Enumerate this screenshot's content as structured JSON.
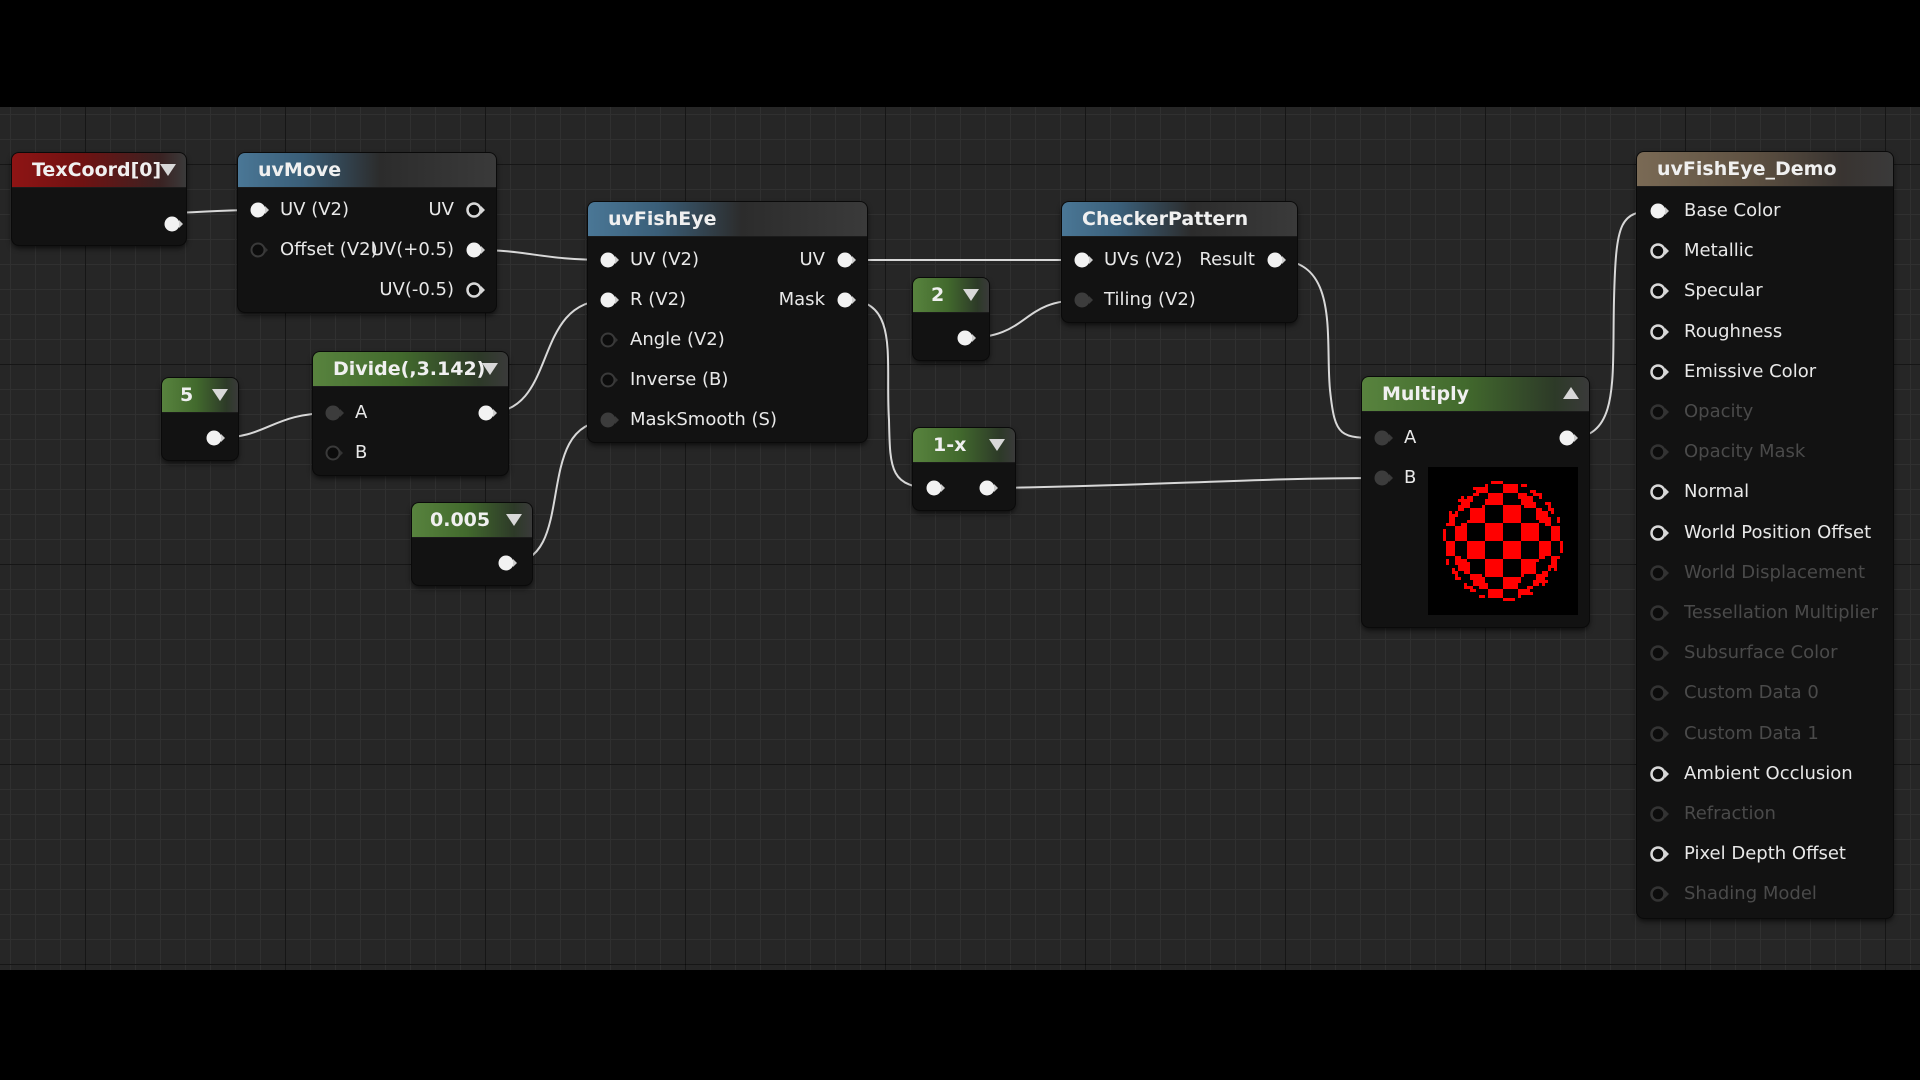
{
  "editor": {
    "type": "material-graph",
    "colors": {
      "background": "#262626",
      "wire": "#d8d8d8",
      "preview_red": "#ff0000",
      "preview_black": "#000000",
      "header_function": "#4a7796",
      "header_texcoord": "#8e1414",
      "header_constant": "#58833e",
      "header_result": "#7a6a55"
    }
  },
  "nodes": {
    "texcoord": {
      "title": "TexCoord[0]"
    },
    "uvmove": {
      "title": "uvMove",
      "inputs": [
        "UV (V2)",
        "Offset (V2)"
      ],
      "outputs": [
        "UV",
        "UV(+0.5)",
        "UV(-0.5)"
      ]
    },
    "const5": {
      "title": "5"
    },
    "divide": {
      "title": "Divide(,3.142)",
      "inputs": [
        "A",
        "B"
      ]
    },
    "const0005": {
      "title": "0.005"
    },
    "uvfisheye": {
      "title": "uvFishEye",
      "inputs": [
        "UV (V2)",
        "R (V2)",
        "Angle (V2)",
        "Inverse (B)",
        "MaskSmooth (S)"
      ],
      "outputs": [
        "UV",
        "Mask"
      ]
    },
    "const2": {
      "title": "2"
    },
    "oneminus": {
      "title": "1-x"
    },
    "checker": {
      "title": "CheckerPattern",
      "inputs": [
        "UVs (V2)",
        "Tiling (V2)"
      ],
      "outputs": [
        "Result"
      ]
    },
    "multiply": {
      "title": "Multiply",
      "inputs": [
        "A",
        "B"
      ],
      "preview": "red-black fisheye checker sphere"
    },
    "result": {
      "title": "uvFishEye_Demo",
      "inputs": [
        {
          "label": "Base Color",
          "state": "connected"
        },
        {
          "label": "Metallic",
          "state": "enabled"
        },
        {
          "label": "Specular",
          "state": "enabled"
        },
        {
          "label": "Roughness",
          "state": "enabled"
        },
        {
          "label": "Emissive Color",
          "state": "enabled"
        },
        {
          "label": "Opacity",
          "state": "disabled"
        },
        {
          "label": "Opacity Mask",
          "state": "disabled"
        },
        {
          "label": "Normal",
          "state": "enabled"
        },
        {
          "label": "World Position Offset",
          "state": "enabled"
        },
        {
          "label": "World Displacement",
          "state": "disabled"
        },
        {
          "label": "Tessellation Multiplier",
          "state": "disabled"
        },
        {
          "label": "Subsurface Color",
          "state": "disabled"
        },
        {
          "label": "Custom Data 0",
          "state": "disabled"
        },
        {
          "label": "Custom Data 1",
          "state": "disabled"
        },
        {
          "label": "Ambient Occlusion",
          "state": "enabled"
        },
        {
          "label": "Refraction",
          "state": "disabled"
        },
        {
          "label": "Pixel Depth Offset",
          "state": "enabled"
        },
        {
          "label": "Shading Model",
          "state": "disabled"
        }
      ]
    }
  },
  "connections": [
    {
      "from": "TexCoord[0].out",
      "to": "uvMove.UV (V2)"
    },
    {
      "from": "uvMove.UV(+0.5)",
      "to": "uvFishEye.UV (V2)"
    },
    {
      "from": "5.out",
      "to": "Divide.A"
    },
    {
      "from": "Divide.out",
      "to": "uvFishEye.R (V2)"
    },
    {
      "from": "0.005.out",
      "to": "uvFishEye.MaskSmooth (S)"
    },
    {
      "from": "uvFishEye.UV",
      "to": "CheckerPattern.UVs (V2)"
    },
    {
      "from": "uvFishEye.Mask",
      "to": "1-x.in"
    },
    {
      "from": "2.out",
      "to": "CheckerPattern.Tiling (V2)"
    },
    {
      "from": "CheckerPattern.Result",
      "to": "Multiply.A"
    },
    {
      "from": "1-x.out",
      "to": "Multiply.B"
    },
    {
      "from": "Multiply.out",
      "to": "uvFishEye_Demo.Base Color"
    }
  ]
}
